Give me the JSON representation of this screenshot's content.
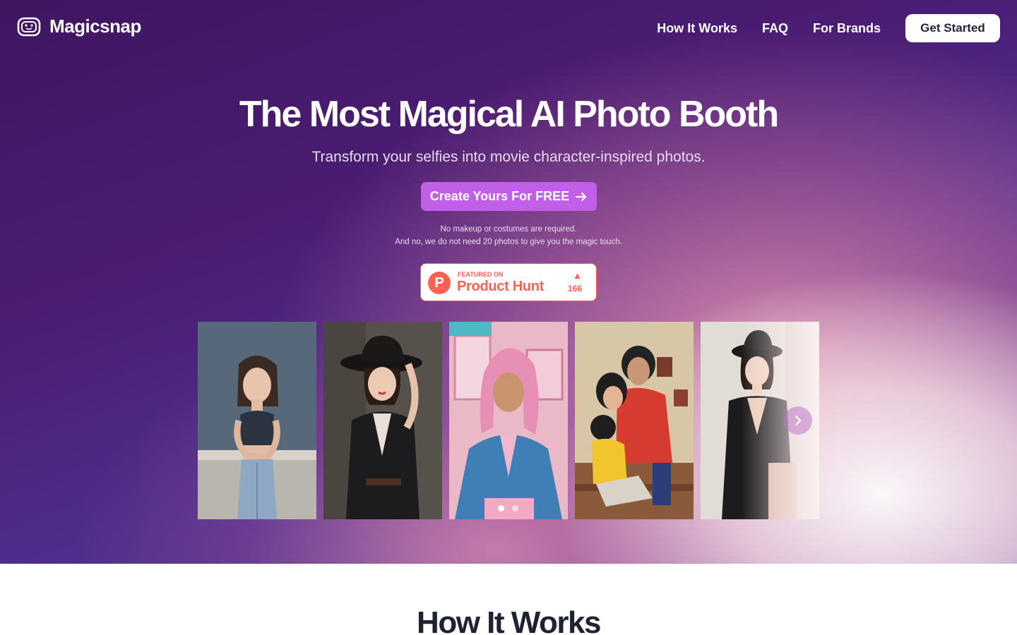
{
  "header": {
    "brand": "Magicsnap",
    "nav": [
      {
        "label": "How It Works"
      },
      {
        "label": "FAQ"
      },
      {
        "label": "For Brands"
      }
    ],
    "cta_label": "Get Started"
  },
  "hero": {
    "headline": "The Most Magical AI Photo Booth",
    "subheadline": "Transform your selfies into movie character-inspired photos.",
    "cta_label": "Create Yours For FREE",
    "note_line1": "No makeup or costumes are required.",
    "note_line2": "And no, we do not need 20 photos to give you the magic touch."
  },
  "product_hunt": {
    "small_label": "FEATURED ON",
    "big_label": "Product Hunt",
    "upvotes": "166"
  },
  "carousel": {
    "photos": [
      {
        "name": "photo-girl-denim"
      },
      {
        "name": "photo-woman-black-hat"
      },
      {
        "name": "photo-man-pink-hair"
      },
      {
        "name": "photo-family-anime"
      },
      {
        "name": "photo-woman-black-dress"
      }
    ],
    "active_dot": 0,
    "dot_count": 2
  },
  "section": {
    "title": "How It Works"
  },
  "colors": {
    "accent": "#c25fe8",
    "product_hunt": "#ff6154",
    "heading_dark": "#1f2330"
  }
}
